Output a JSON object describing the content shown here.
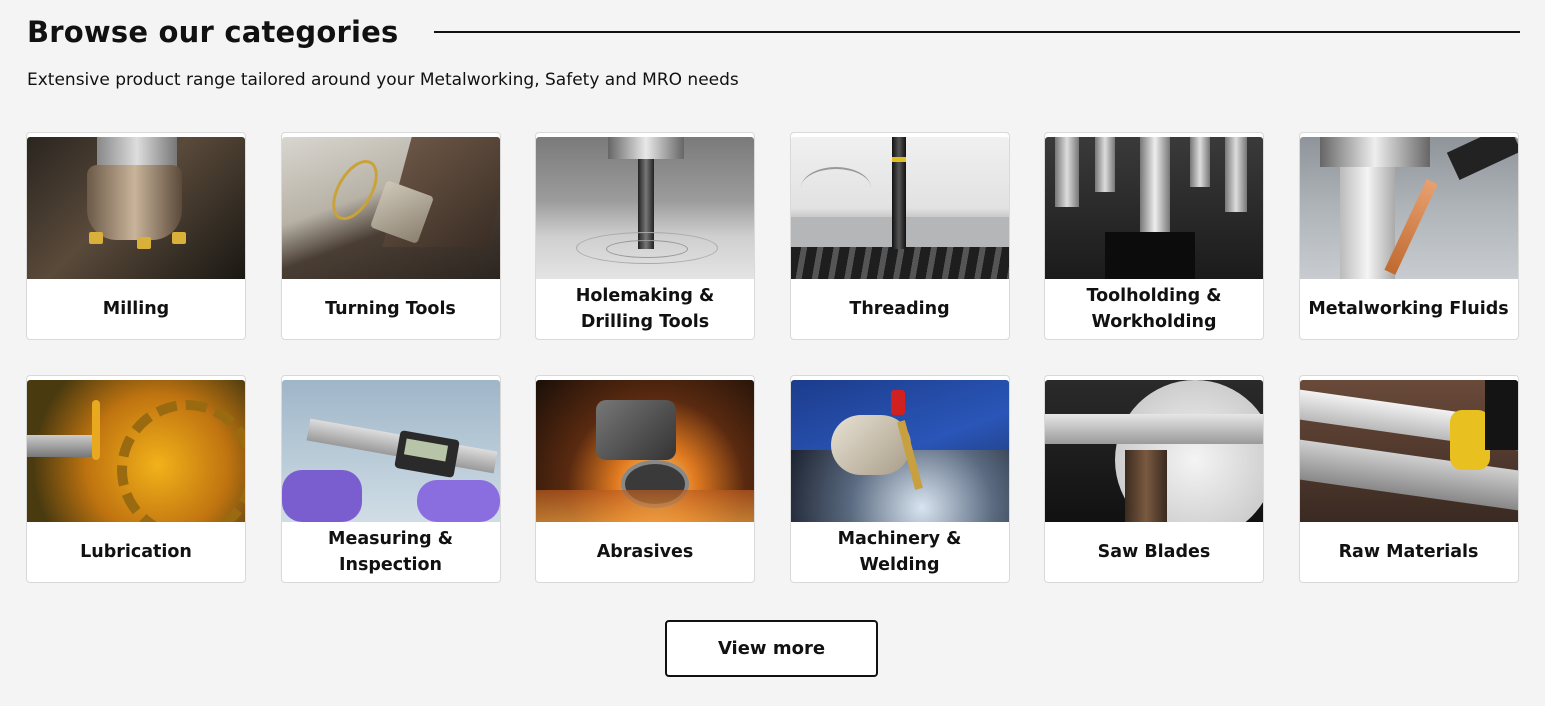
{
  "section": {
    "title": "Browse our categories",
    "subtitle": "Extensive product range tailored around your Metalworking, Safety and MRO needs"
  },
  "categories": [
    {
      "label": "Milling",
      "image": "milling-cutter-photo"
    },
    {
      "label": "Turning Tools",
      "image": "turning-insert-photo"
    },
    {
      "label": "Holemaking & Drilling Tools",
      "image": "drill-bit-photo"
    },
    {
      "label": "Threading",
      "image": "tap-threading-photo"
    },
    {
      "label": "Toolholding & Workholding",
      "image": "tool-holders-photo"
    },
    {
      "label": "Metalworking Fluids",
      "image": "coolant-spray-photo"
    },
    {
      "label": "Lubrication",
      "image": "oil-gear-photo"
    },
    {
      "label": "Measuring & Inspection",
      "image": "digital-caliper-photo"
    },
    {
      "label": "Abrasives",
      "image": "angle-grinder-sparks-photo"
    },
    {
      "label": "Machinery & Welding",
      "image": "welding-torch-photo"
    },
    {
      "label": "Saw Blades",
      "image": "band-saw-blade-photo"
    },
    {
      "label": "Raw Materials",
      "image": "metal-bars-photo"
    }
  ],
  "actions": {
    "view_more": "View more"
  }
}
